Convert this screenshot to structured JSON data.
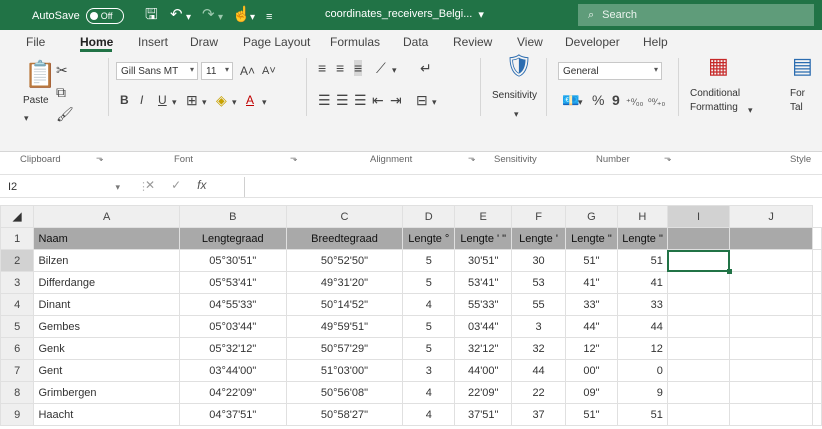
{
  "titlebar": {
    "autosave_label": "AutoSave",
    "autosave_state": "Off",
    "filename": "coordinates_receivers_Belgi...",
    "filename_chevron": "▾",
    "search_placeholder": "Search"
  },
  "tabs": [
    "File",
    "Home",
    "Insert",
    "Draw",
    "Page Layout",
    "Formulas",
    "Data",
    "Review",
    "View",
    "Developer",
    "Help"
  ],
  "active_tab": "Home",
  "ribbon": {
    "clipboard": {
      "paste": "Paste",
      "label": "Clipboard"
    },
    "font": {
      "name": "Gill Sans MT",
      "size": "11",
      "bold": "B",
      "italic": "I",
      "underline": "U",
      "grow": "A˄",
      "shrink": "A˅",
      "label": "Font"
    },
    "alignment": {
      "label": "Alignment"
    },
    "sensitivity": {
      "button": "Sensitivity",
      "label": "Sensitivity"
    },
    "number": {
      "format": "General",
      "percent": "%",
      "comma": "9",
      "inc_decimal": "⁺⁰⁄₀₀",
      "dec_decimal": "⁰⁰⁄₊₀",
      "label": "Number"
    },
    "styles": {
      "conditional_line1": "Conditional",
      "conditional_line2": "Formatting",
      "format_table_line1": "For",
      "format_table_line2": "Tal",
      "label": "Style"
    }
  },
  "formula_bar": {
    "name_box": "I2",
    "cancel": "✕",
    "enter": "✓",
    "fx": "fx",
    "value": ""
  },
  "colors": {
    "accent": "#217346",
    "header_row": "#a9a9a9"
  },
  "columns": [
    "A",
    "B",
    "C",
    "D",
    "E",
    "F",
    "G",
    "H",
    "I",
    "J"
  ],
  "rows": [
    {
      "num": "1",
      "cells": [
        "Naam",
        "Lengtegraad",
        "Breedtegraad",
        "Lengte °",
        "Lengte ' \"",
        "Lengte '",
        "Lengte \"",
        "Lengte \"",
        "",
        ""
      ]
    },
    {
      "num": "2",
      "cells": [
        "Bilzen",
        "05°30'51\"",
        "50°52'50\"",
        "5",
        "30'51\"",
        "30",
        "51\"",
        "51",
        "",
        ""
      ]
    },
    {
      "num": "3",
      "cells": [
        "Differdange",
        "05°53'41\"",
        "49°31'20\"",
        "5",
        "53'41\"",
        "53",
        "41\"",
        "41",
        "",
        ""
      ]
    },
    {
      "num": "4",
      "cells": [
        "Dinant",
        "04°55'33\"",
        "50°14'52\"",
        "4",
        "55'33\"",
        "55",
        "33\"",
        "33",
        "",
        ""
      ]
    },
    {
      "num": "5",
      "cells": [
        "Gembes",
        "05°03'44\"",
        "49°59'51\"",
        "5",
        "03'44\"",
        "3",
        "44\"",
        "44",
        "",
        ""
      ]
    },
    {
      "num": "6",
      "cells": [
        "Genk",
        "05°32'12\"",
        "50°57'29\"",
        "5",
        "32'12\"",
        "32",
        "12\"",
        "12",
        "",
        ""
      ]
    },
    {
      "num": "7",
      "cells": [
        "Gent",
        "03°44'00\"",
        "51°03'00\"",
        "3",
        "44'00\"",
        "44",
        "00\"",
        "0",
        "",
        ""
      ]
    },
    {
      "num": "8",
      "cells": [
        "Grimbergen",
        "04°22'09\"",
        "50°56'08\"",
        "4",
        "22'09\"",
        "22",
        "09\"",
        "9",
        "",
        ""
      ]
    },
    {
      "num": "9",
      "cells": [
        "Haacht",
        "04°37'51\"",
        "50°58'27\"",
        "4",
        "37'51\"",
        "37",
        "51\"",
        "51",
        "",
        ""
      ]
    }
  ],
  "selected_cell": "I2"
}
